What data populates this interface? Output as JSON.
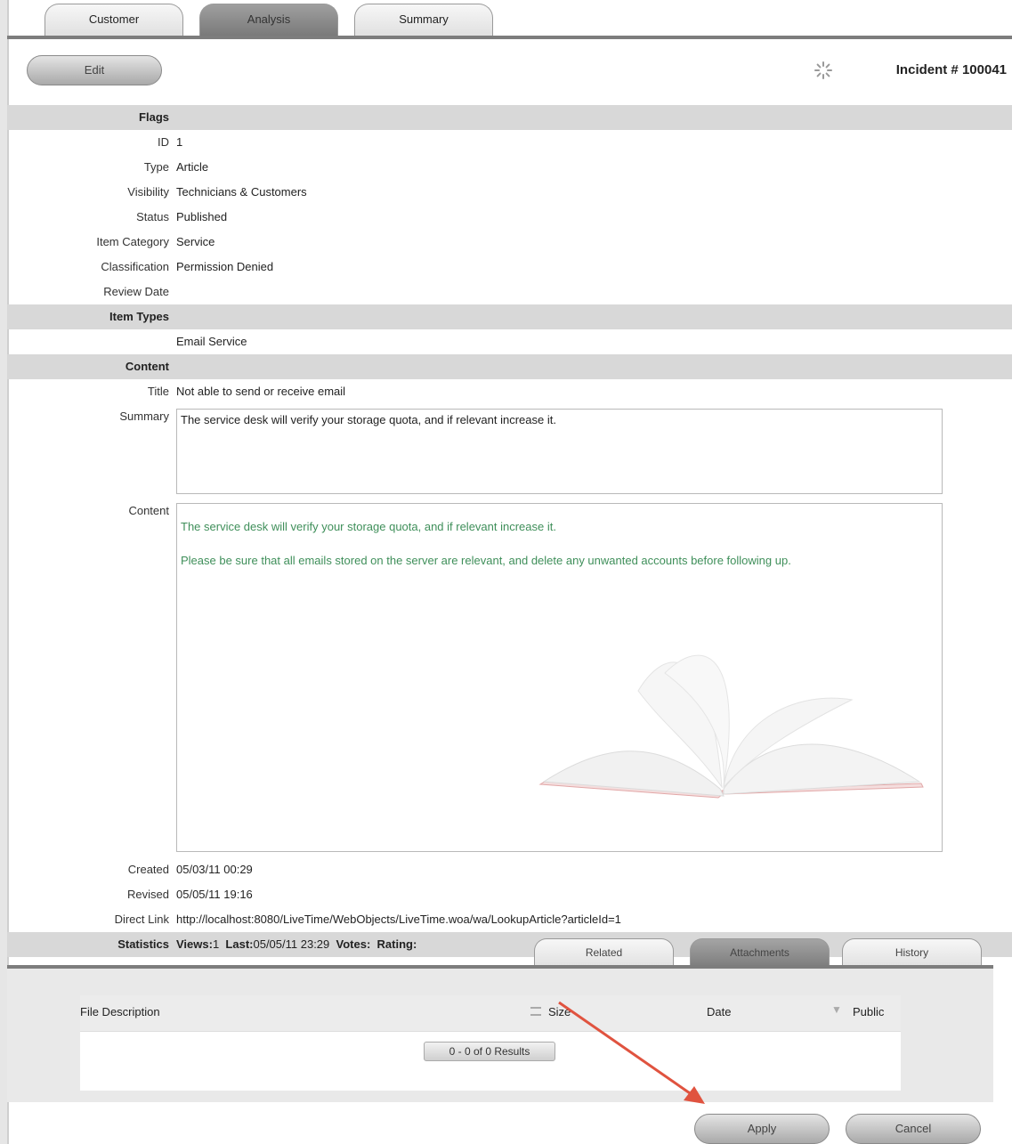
{
  "tabs": [
    "Customer",
    "Analysis",
    "Summary"
  ],
  "header": {
    "edit_label": "Edit",
    "incident": "Incident # 100041"
  },
  "fields": {
    "flags_header": "Flags",
    "id_label": "ID",
    "id_value": "1",
    "type_label": "Type",
    "type_value": "Article",
    "visibility_label": "Visibility",
    "visibility_value": "Technicians & Customers",
    "status_label": "Status",
    "status_value": "Published",
    "item_category_label": "Item Category",
    "item_category_value": "Service",
    "classification_label": "Classification",
    "classification_value": "Permission Denied",
    "review_date_label": "Review Date",
    "item_types_header": "Item Types",
    "item_type_value": "Email Service",
    "content_header": "Content",
    "title_label": "Title",
    "title_value": "Not able to send or receive email",
    "summary_label": "Summary",
    "summary_value": "The service desk will verify your storage quota, and if relevant increase it.",
    "content_label": "Content",
    "content_para1": "The service desk will verify your storage quota, and if relevant increase it.",
    "content_para2": "Please be sure that all emails stored on the server are relevant, and delete any unwanted accounts before following up.",
    "created_label": "Created",
    "created_value": "05/03/11 00:29",
    "revised_label": "Revised",
    "revised_value": "05/05/11 19:16",
    "direct_link_label": "Direct Link",
    "direct_link_value": "http://localhost:8080/LiveTime/WebObjects/LiveTime.woa/wa/LookupArticle?articleId=1",
    "statistics_label": "Statistics",
    "views_label": "Views:",
    "views_value": "1",
    "last_label": "Last:",
    "last_value": "05/05/11 23:29",
    "votes_label": "Votes:",
    "rating_label": "Rating:"
  },
  "bottom_tabs": [
    "Related",
    "Attachments",
    "History"
  ],
  "attachments": {
    "columns": [
      "File Description",
      "Size",
      "Date",
      "Public"
    ],
    "results": "0 - 0 of 0 Results"
  },
  "actions": {
    "apply_label": "Apply",
    "cancel_label": "Cancel"
  },
  "colors": {
    "content_text": "#3f8f5a",
    "section_bg": "#d8d8d8",
    "arrow": "#e0533f"
  }
}
